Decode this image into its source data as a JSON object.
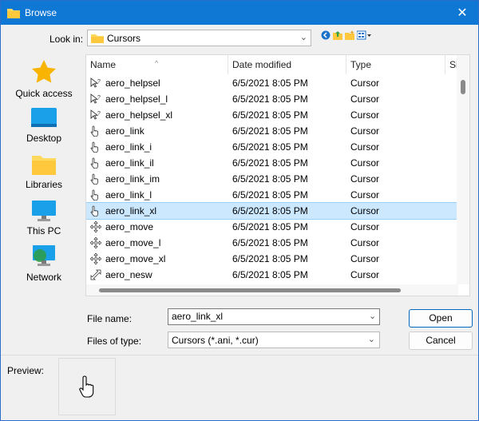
{
  "window": {
    "title": "Browse",
    "close_glyph": "✕"
  },
  "lookin": {
    "label": "Look in:",
    "value": "Cursors"
  },
  "places": [
    {
      "label": "Quick access",
      "icon": "star-icon"
    },
    {
      "label": "Desktop",
      "icon": "desktop-icon"
    },
    {
      "label": "Libraries",
      "icon": "libraries-icon"
    },
    {
      "label": "This PC",
      "icon": "this-pc-icon"
    },
    {
      "label": "Network",
      "icon": "network-icon"
    }
  ],
  "columns": {
    "name": "Name",
    "date": "Date modified",
    "type": "Type",
    "size": "Siz"
  },
  "files": [
    {
      "name": "aero_helpsel",
      "date": "6/5/2021 8:05 PM",
      "type": "Cursor",
      "icon": "help-cursor-icon"
    },
    {
      "name": "aero_helpsel_l",
      "date": "6/5/2021 8:05 PM",
      "type": "Cursor",
      "icon": "help-cursor-icon"
    },
    {
      "name": "aero_helpsel_xl",
      "date": "6/5/2021 8:05 PM",
      "type": "Cursor",
      "icon": "help-cursor-icon"
    },
    {
      "name": "aero_link",
      "date": "6/5/2021 8:05 PM",
      "type": "Cursor",
      "icon": "hand-cursor-icon"
    },
    {
      "name": "aero_link_i",
      "date": "6/5/2021 8:05 PM",
      "type": "Cursor",
      "icon": "hand-cursor-icon"
    },
    {
      "name": "aero_link_il",
      "date": "6/5/2021 8:05 PM",
      "type": "Cursor",
      "icon": "hand-cursor-icon"
    },
    {
      "name": "aero_link_im",
      "date": "6/5/2021 8:05 PM",
      "type": "Cursor",
      "icon": "hand-cursor-icon"
    },
    {
      "name": "aero_link_l",
      "date": "6/5/2021 8:05 PM",
      "type": "Cursor",
      "icon": "hand-cursor-icon"
    },
    {
      "name": "aero_link_xl",
      "date": "6/5/2021 8:05 PM",
      "type": "Cursor",
      "icon": "hand-cursor-icon",
      "selected": true
    },
    {
      "name": "aero_move",
      "date": "6/5/2021 8:05 PM",
      "type": "Cursor",
      "icon": "move-cursor-icon"
    },
    {
      "name": "aero_move_l",
      "date": "6/5/2021 8:05 PM",
      "type": "Cursor",
      "icon": "move-cursor-icon"
    },
    {
      "name": "aero_move_xl",
      "date": "6/5/2021 8:05 PM",
      "type": "Cursor",
      "icon": "move-cursor-icon"
    },
    {
      "name": "aero_nesw",
      "date": "6/5/2021 8:05 PM",
      "type": "Cursor",
      "icon": "resize-diagonal-cursor-icon"
    }
  ],
  "filename": {
    "label": "File name:",
    "value": "aero_link_xl"
  },
  "filetype": {
    "label": "Files of type:",
    "value": "Cursors (*.ani, *.cur)"
  },
  "buttons": {
    "open": "Open",
    "cancel": "Cancel"
  },
  "preview": {
    "label": "Preview:"
  },
  "colors": {
    "titlebar": "#0f78d4",
    "selection": "#cce8ff"
  }
}
